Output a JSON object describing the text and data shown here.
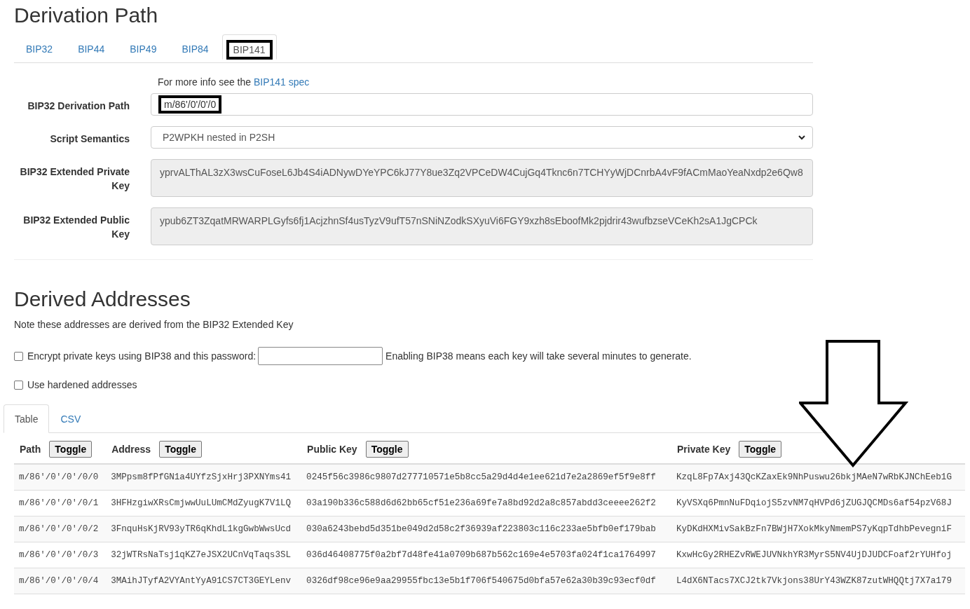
{
  "heading": "Derivation Path",
  "tabs": [
    {
      "label": "BIP32",
      "selected": false,
      "annotated": false
    },
    {
      "label": "BIP44",
      "selected": false,
      "annotated": false
    },
    {
      "label": "BIP49",
      "selected": false,
      "annotated": false
    },
    {
      "label": "BIP84",
      "selected": false,
      "annotated": false
    },
    {
      "label": "BIP141",
      "selected": true,
      "annotated": true
    }
  ],
  "info": {
    "text": "For more info see the",
    "link": "BIP141 spec"
  },
  "fields": [
    {
      "kind": "input",
      "label": "BIP32 Derivation Path",
      "value": "m/86'/0'/0'/0",
      "annotated": true
    },
    {
      "kind": "select",
      "label": "Script Semantics",
      "value": "P2WPKH nested in P2SH"
    },
    {
      "kind": "textarea",
      "label": "BIP32 Extended Private Key",
      "value": "yprvALThAL3zX3wsCuFoseL6Jb4S4iADNywDYeYPC6kJ77Y8ue3Zq2VPCeDW4CujGq4Tknc6n7TCHYyWjDCnrbA4vF9fACmMaoYeaNxdp2e6Qw8"
    },
    {
      "kind": "textarea",
      "label": "BIP32 Extended Public Key",
      "value": "ypub6ZT3ZqatMRWARPLGyfs6fj1AcjzhnSf4usTyzV9ufT57nSNiNZodkSXyuVi6FGY9xzh8sEboofMk2pjdrir43wufbzseVCeKh2sA1JgCPCk"
    }
  ],
  "derived": {
    "heading": "Derived Addresses",
    "note": "Note these addresses are derived from the BIP32 Extended Key"
  },
  "options": [
    {
      "kind": "password",
      "label": "Encrypt private keys using BIP38 and this password:",
      "checked": false,
      "hint": "Enabling BIP38 means each key will take several minutes to generate."
    },
    {
      "kind": "plain",
      "label": "Use hardened addresses",
      "checked": false
    }
  ],
  "view_tabs": [
    {
      "label": "Table",
      "selected": true
    },
    {
      "label": "CSV",
      "selected": false
    }
  ],
  "table": {
    "columns": [
      {
        "label": "Path",
        "toggle": "Toggle"
      },
      {
        "label": "Address",
        "toggle": "Toggle"
      },
      {
        "label": "Public Key",
        "toggle": "Toggle"
      },
      {
        "label": "Private Key",
        "toggle": "Toggle"
      }
    ],
    "rows": [
      [
        "m/86'/0'/0'/0/0",
        "3MPpsm8fPfGN1a4UYfzSjxHrj3PXNYms41",
        "0245f56c3986c9807d277710571e5b8cc5a29d4d4e1ee621d7e2a2869ef5f9e8ff",
        "KzqL8Fp7Axj43QcKZaxEk9NhPuswu26bkjMAeN7wRbKJNChEeb1G"
      ],
      [
        "m/86'/0'/0'/0/1",
        "3HFHzgiwXRsCmjwwUuLUmCMdZyugK7V1LQ",
        "03a190b336c588d6d62bb65cf51e236a69fe7a8bd92d2a8c857abdd3ceeee262f2",
        "KyVSXq6PmnNuFDqiojS5zvNM7qHVPd6jZUGJQCMDs6af54pzV68J"
      ],
      [
        "m/86'/0'/0'/0/2",
        "3FnquHsKjRV93yTR6qKhdL1kgGwbWwsUcd",
        "030a6243bebd5d351be049d2d58c2f36939af223803c116c233ae5bfb0ef179bab",
        "KyDKdHXMivSakBzFn7BWjH7XokMkyNmemPS7yKqpTdhbPevegniF"
      ],
      [
        "m/86'/0'/0'/0/3",
        "32jWTRsNaTsj1qKZ7eJSX2UCnVqTaqs3SL",
        "036d46408775f0a2bf7d48fe41a0709b687b562c169e4e5703fa024f1ca1764997",
        "KxwHcGy2RHEZvRWEJUVNkhYR3MyrS5NV4UjDJUDCFoaf2rYUHfoj"
      ],
      [
        "m/86'/0'/0'/0/4",
        "3MAihJTyfA2VYAntYyA91CS7CT3GEYLenv",
        "0326df98ce96e9aa29955fbc13e5b1f706f540675d0bfa57e62a30b39c93ecf0df",
        "L4dX6NTacs7XCJ2tk7Vkjons38UrY43WZK87zutWHQQtj7X7a179"
      ]
    ]
  }
}
